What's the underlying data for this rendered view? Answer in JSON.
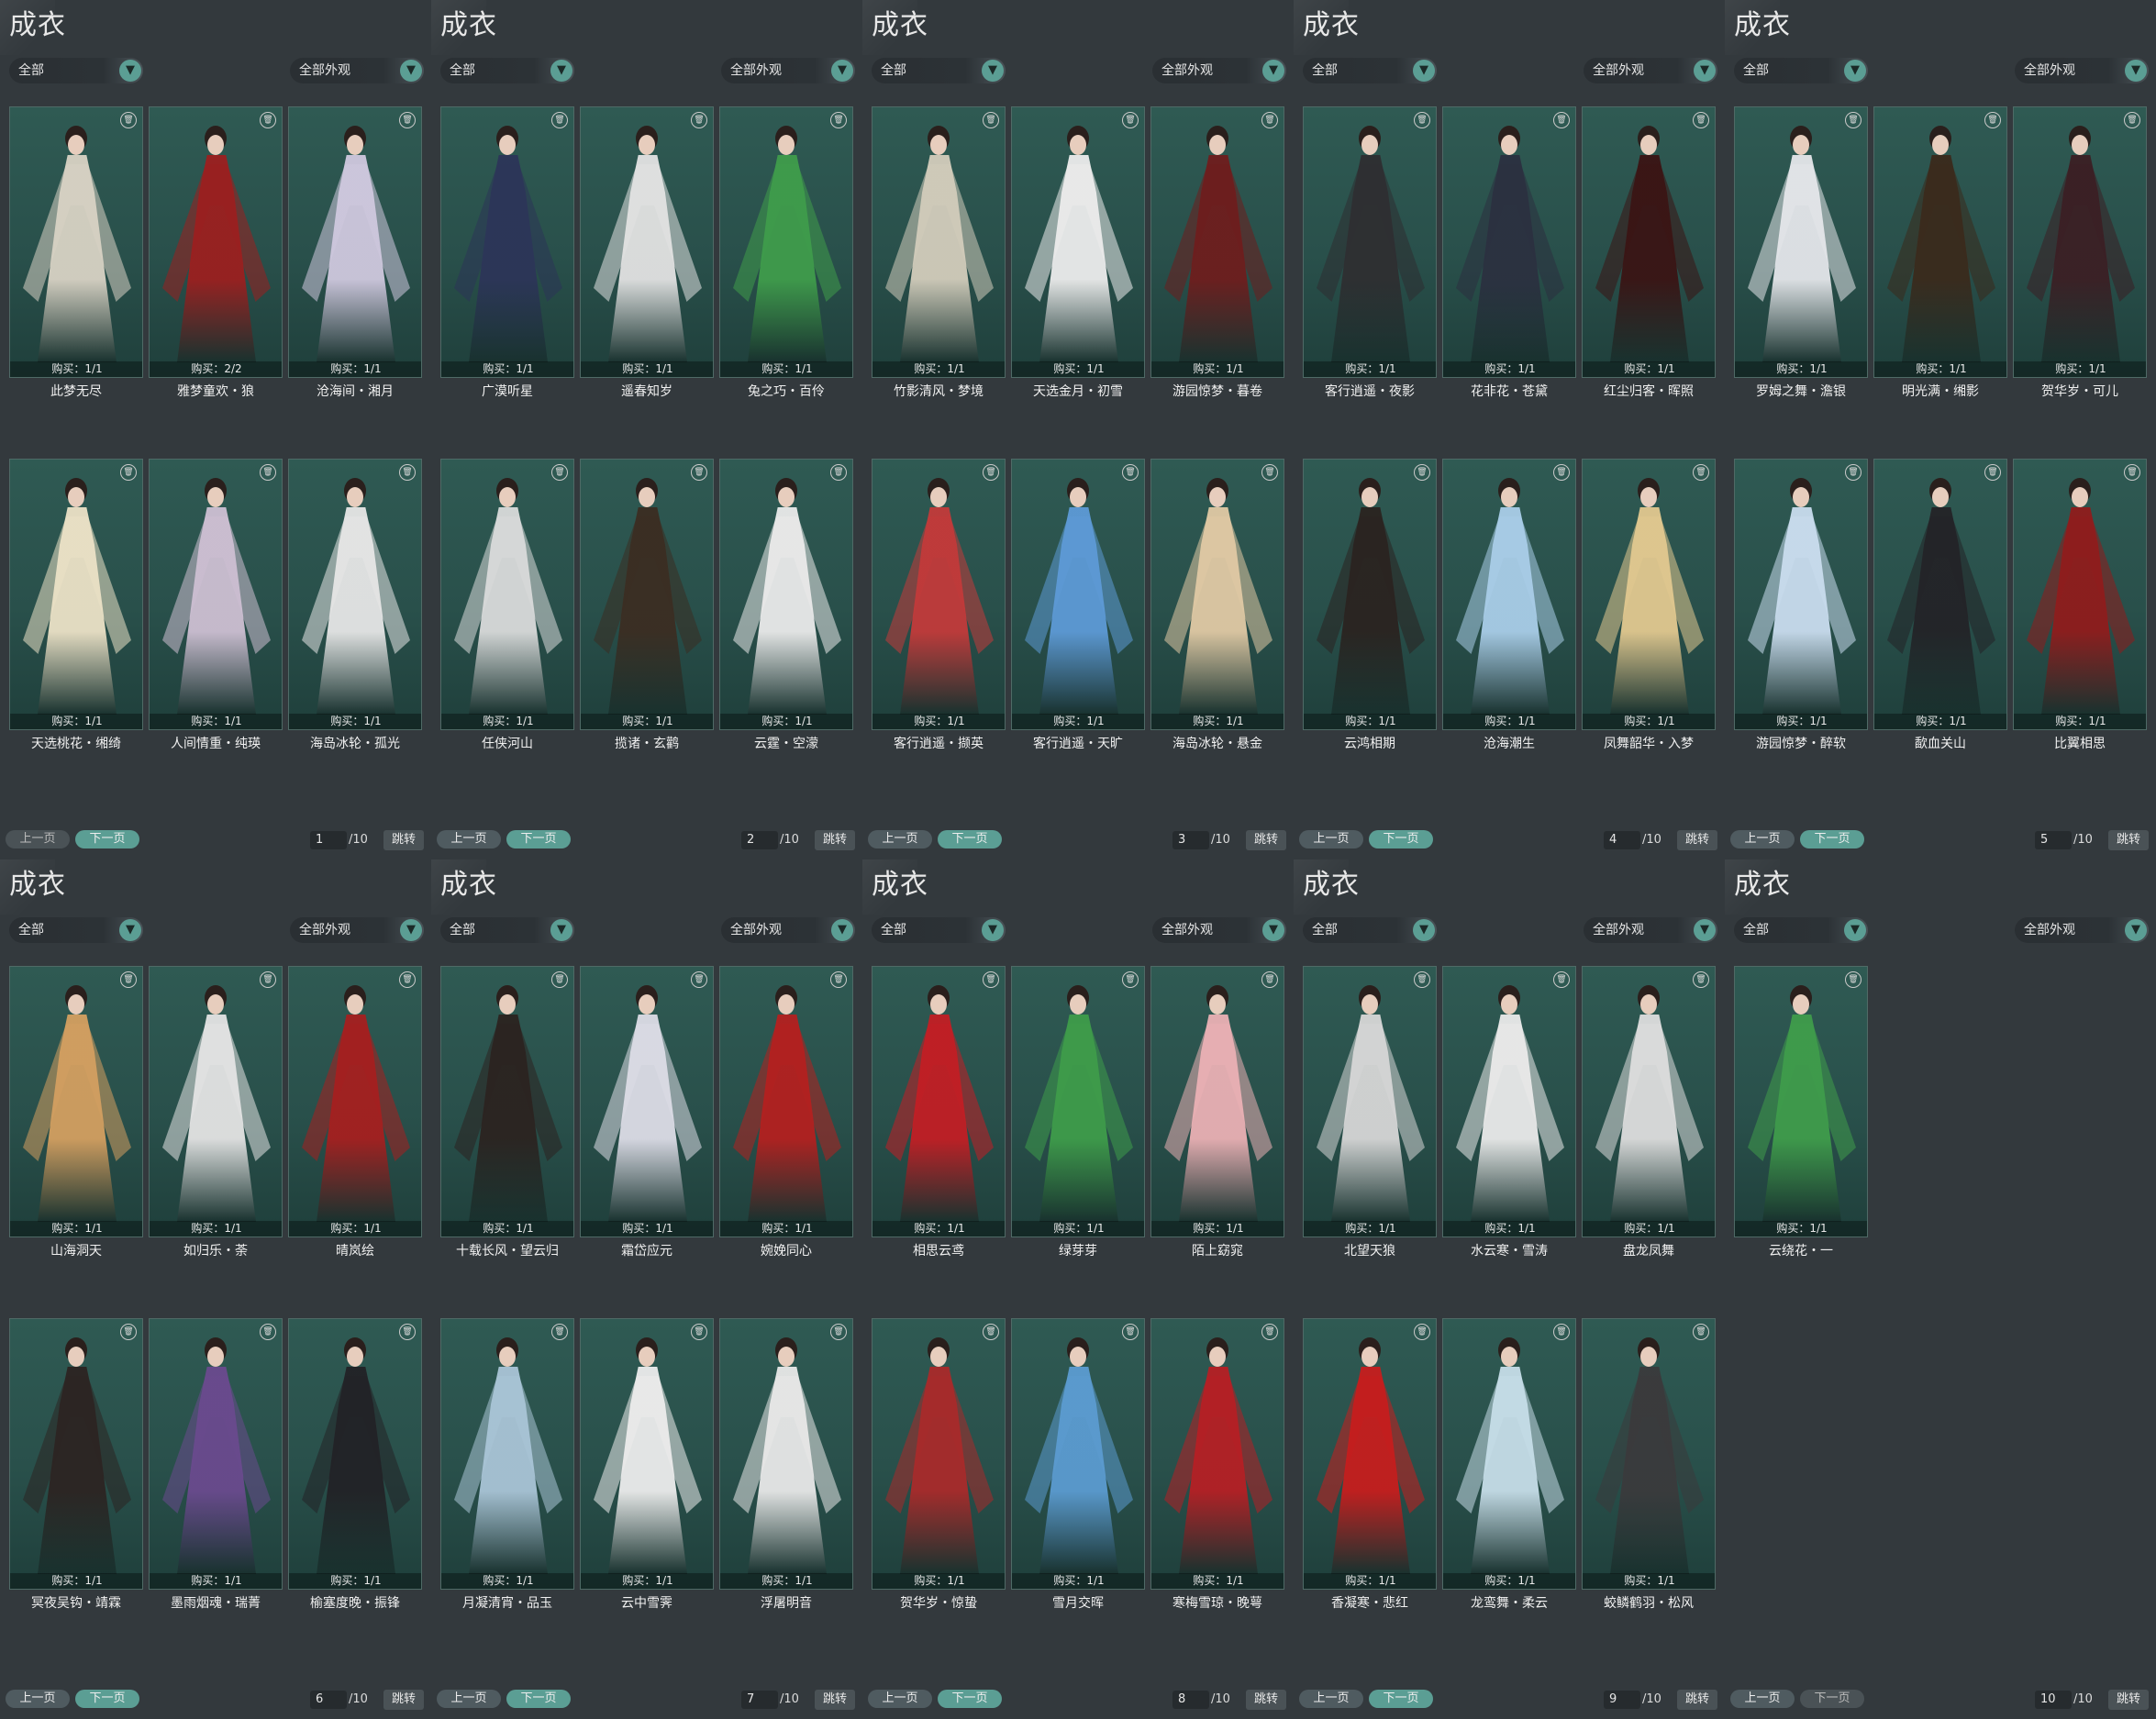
{
  "panel_title": "成衣",
  "filter_left": "全部",
  "filter_right": "全部外观",
  "prev_label": "上一页",
  "next_label": "下一页",
  "jump_label": "跳转",
  "total_pages": "/10",
  "colors": {
    "accent": "#5b9e94",
    "card_bg": "#2f5a53",
    "page_bg": "#33393d"
  },
  "panels": [
    {
      "page": "1",
      "items": [
        {
          "name": "此梦无尽",
          "buy": "购买：1/1",
          "color": "#d8d2c4"
        },
        {
          "name": "雅梦童欢・狼",
          "buy": "购买：2/2",
          "color": "#9b1f1f"
        },
        {
          "name": "沧海间・湘月",
          "buy": "购买：1/1",
          "color": "#cfc8de"
        },
        {
          "name": "天选桃花・缃绮",
          "buy": "购买：1/1",
          "color": "#ebe1c6"
        },
        {
          "name": "人间情重・纯瑛",
          "buy": "购买：1/1",
          "color": "#cdbfd2"
        },
        {
          "name": "海岛冰轮・孤光",
          "buy": "购买：1/1",
          "color": "#e6e6e6"
        }
      ]
    },
    {
      "page": "2",
      "items": [
        {
          "name": "广漠听星",
          "buy": "购买：1/1",
          "color": "#2c3558"
        },
        {
          "name": "遥春知岁",
          "buy": "购买：1/1",
          "color": "#e2e2e2"
        },
        {
          "name": "兔之巧・百伶",
          "buy": "购买：1/1",
          "color": "#3f9c4b"
        },
        {
          "name": "任侠河山",
          "buy": "购买：1/1",
          "color": "#d9dada"
        },
        {
          "name": "揽诸・玄鹳",
          "buy": "购买：1/1",
          "color": "#3b2d22"
        },
        {
          "name": "云霆・空濛",
          "buy": "购买：1/1",
          "color": "#eaeaea"
        }
      ]
    },
    {
      "page": "3",
      "items": [
        {
          "name": "竹影清风・梦境",
          "buy": "购买：1/1",
          "color": "#d2ccbb"
        },
        {
          "name": "天选金月・初雪",
          "buy": "购买：1/1",
          "color": "#ececec"
        },
        {
          "name": "游园惊梦・暮卷",
          "buy": "购买：1/1",
          "color": "#6e1d1d"
        },
        {
          "name": "客行逍遥・撷英",
          "buy": "购买：1/1",
          "color": "#c23a3a"
        },
        {
          "name": "客行逍遥・天旷",
          "buy": "购买：1/1",
          "color": "#5d9ad6"
        },
        {
          "name": "海岛冰轮・悬金",
          "buy": "购买：1/1",
          "color": "#e0c9a4"
        }
      ]
    },
    {
      "page": "4",
      "items": [
        {
          "name": "客行逍遥・夜影",
          "buy": "购买：1/1",
          "color": "#2e2e31"
        },
        {
          "name": "花非花・苍黛",
          "buy": "购买：1/1",
          "color": "#2b3040"
        },
        {
          "name": "红尘归客・晖照",
          "buy": "购买：1/1",
          "color": "#3a1414"
        },
        {
          "name": "云鸿相期",
          "buy": "购买：1/1",
          "color": "#2a2320"
        },
        {
          "name": "沧海潮生",
          "buy": "购买：1/1",
          "color": "#a9cde8"
        },
        {
          "name": "凤舞韶华・入梦",
          "buy": "购买：1/1",
          "color": "#e1c88f"
        }
      ]
    },
    {
      "page": "5",
      "items": [
        {
          "name": "罗姆之舞・澹银",
          "buy": "购买：1/1",
          "color": "#e4e6ea"
        },
        {
          "name": "明光满・缃影",
          "buy": "购买：1/1",
          "color": "#3a2a1c"
        },
        {
          "name": "贺华岁・可儿",
          "buy": "购买：1/1",
          "color": "#3b1f24"
        },
        {
          "name": "游园惊梦・醉软",
          "buy": "购买：1/1",
          "color": "#c9dcee"
        },
        {
          "name": "歃血关山",
          "buy": "购买：1/1",
          "color": "#232327"
        },
        {
          "name": "比翼相思",
          "buy": "购买：1/1",
          "color": "#8f1c1c"
        }
      ]
    },
    {
      "page": "6",
      "items": [
        {
          "name": "山海洞天",
          "buy": "购买：1/1",
          "color": "#d39f60"
        },
        {
          "name": "如归乐・荼",
          "buy": "购买：1/1",
          "color": "#e3e3e3"
        },
        {
          "name": "晴岚绘",
          "buy": "购买：1/1",
          "color": "#a51f1f"
        },
        {
          "name": "冥夜吴钩・靖霖",
          "buy": "购买：1/1",
          "color": "#2c2422"
        },
        {
          "name": "墨雨烟魂・瑞菁",
          "buy": "购买：1/1",
          "color": "#6a4a8e"
        },
        {
          "name": "榆塞度晚・振锋",
          "buy": "购买：1/1",
          "color": "#222226"
        }
      ]
    },
    {
      "page": "7",
      "items": [
        {
          "name": "十载长风・望云归",
          "buy": "购买：1/1",
          "color": "#2b2320"
        },
        {
          "name": "霜岱应元",
          "buy": "购买：1/1",
          "color": "#dcdce6"
        },
        {
          "name": "婉娩同心",
          "buy": "购买：1/1",
          "color": "#b3201f"
        },
        {
          "name": "月凝清宵・品玉",
          "buy": "购买：1/1",
          "color": "#a9c4d6"
        },
        {
          "name": "云中雪霁",
          "buy": "购买：1/1",
          "color": "#ececec"
        },
        {
          "name": "浮屠明音",
          "buy": "购买：1/1",
          "color": "#e8e8e8"
        }
      ]
    },
    {
      "page": "8",
      "items": [
        {
          "name": "相思云鸢",
          "buy": "购买：1/1",
          "color": "#c21e24"
        },
        {
          "name": "绿芽芽",
          "buy": "购买：1/1",
          "color": "#3e9c4a"
        },
        {
          "name": "陌上窈窕",
          "buy": "购买：1/1",
          "color": "#eab0b4"
        },
        {
          "name": "贺华岁・惊蛰",
          "buy": "购买：1/1",
          "color": "#a82a2a"
        },
        {
          "name": "雪月交晖",
          "buy": "购买：1/1",
          "color": "#5b9bd0"
        },
        {
          "name": "寒梅雪琼・晚萼",
          "buy": "购买：1/1",
          "color": "#b51f24"
        }
      ]
    },
    {
      "page": "9",
      "items": [
        {
          "name": "北望天狼",
          "buy": "购买：1/1",
          "color": "#d6d6d6"
        },
        {
          "name": "水云寒・雪涛",
          "buy": "购买：1/1",
          "color": "#eaeaea"
        },
        {
          "name": "盘龙凤舞",
          "buy": "购买：1/1",
          "color": "#dddddd"
        },
        {
          "name": "香凝寒・悲红",
          "buy": "购买：1/1",
          "color": "#c61d1d"
        },
        {
          "name": "龙鸾舞・柔云",
          "buy": "购买：1/1",
          "color": "#c6dde8"
        },
        {
          "name": "蛟鳞鹤羽・松风",
          "buy": "购买：1/1",
          "color": "#3a3a3c"
        }
      ]
    },
    {
      "page": "10",
      "items": [
        {
          "name": "云绕花・一",
          "buy": "购买：1/1",
          "color": "#3f9c4b"
        }
      ]
    }
  ]
}
